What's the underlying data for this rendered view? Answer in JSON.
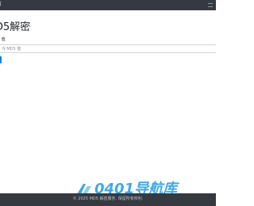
{
  "navbar": {
    "brand_label": "首",
    "toggler_icon": "hamburger-icon"
  },
  "main": {
    "title": "D5解密",
    "field_label": "5 值",
    "input": {
      "value": "",
      "placeholder": "N MD5 值"
    },
    "submit_label": ""
  },
  "footer": {
    "copyright": "© 2025 MD5 解密服务. 保留所有权利."
  },
  "watermark": {
    "text": "0401导航库",
    "color": "#2ea2e6"
  },
  "colors": {
    "navbar_bg": "#343a40",
    "footer_bg": "#343a40",
    "primary_button": "#007bff"
  }
}
